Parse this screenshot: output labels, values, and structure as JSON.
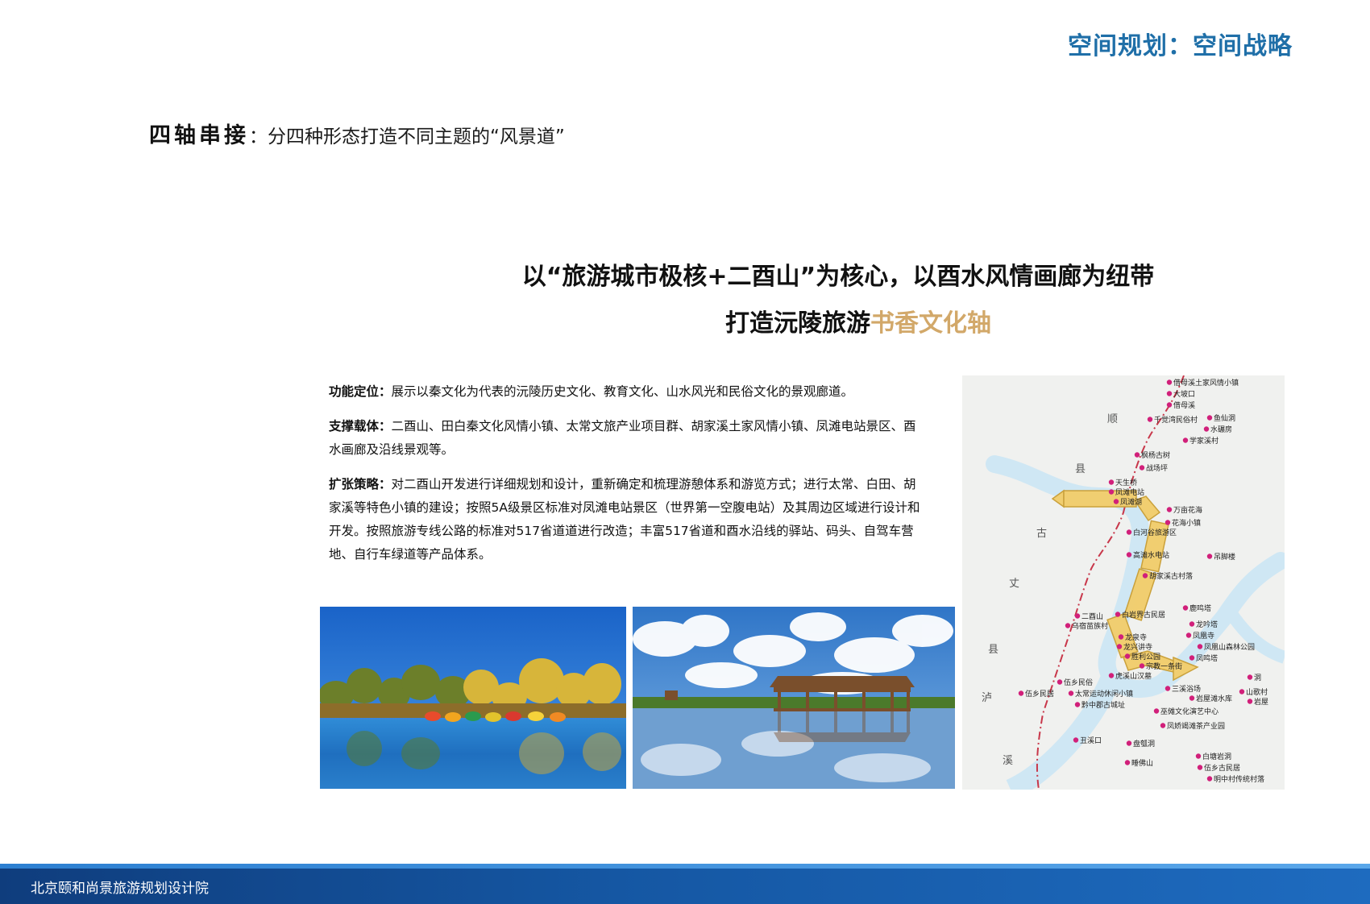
{
  "header": {
    "title": "空间规划：空间战略"
  },
  "section": {
    "axis_label": "四轴串接",
    "separator": "：",
    "subtitle": "分四种形态打造不同主题的“风景道”"
  },
  "headline": {
    "line1": "以“旅游城市极核+二酉山”为核心，以酉水风情画廊为纽带",
    "line2_prefix": "打造沅陵旅游",
    "line2_highlight": "书香文化轴"
  },
  "paragraphs": [
    {
      "label": "功能定位：",
      "text": "展示以秦文化为代表的沅陵历史文化、教育文化、山水风光和民俗文化的景观廊道。"
    },
    {
      "label": "支撑载体：",
      "text": "二酉山、田白秦文化风情小镇、太常文旅产业项目群、胡家溪土家风情小镇、凤滩电站景区、酉水画廊及沿线景观等。"
    },
    {
      "label": "扩张策略：",
      "text": "对二酉山开发进行详细规划和设计，重新确定和梳理游憩体系和游览方式；进行太常、白田、胡家溪等特色小镇的建设；按照5A级景区标准对凤滩电站景区（世界第一空腹电站）及其周边区域进行设计和开发。按照旅游专线公路的标准对517省道道进行改造；丰富517省道和酉水沿线的驿站、码头、自驾车营地、自行车绿道等产品体系。"
    }
  ],
  "map": {
    "county_labels": [
      "顺",
      "县",
      "古",
      "丈",
      "县",
      "泸",
      "溪"
    ],
    "places": [
      "借母溪土家风情小镇",
      "大坡口",
      "借母溪",
      "千觉湾民俗村",
      "鱼仙洞",
      "水碾房",
      "学家溪村",
      "枫杨古树",
      "战场坪",
      "天生桥",
      "凤滩电站",
      "凤滩湖",
      "万亩花海",
      "花海小镇",
      "白河谷旅游区",
      "高滩水电站",
      "吊脚楼",
      "胡家溪古村落",
      "鹿鸣塔",
      "二酉山",
      "白岩界古民居",
      "乌宿苗族村",
      "龙吟塔",
      "龙泉寺",
      "凤凰寺",
      "龙兴讲寺",
      "凤凰山森林公园",
      "胜利公园",
      "宗教一条街",
      "凤鸣塔",
      "虎溪山汉墓",
      "伍乡民居",
      "伍乡民俗",
      "太常运动休闲小镇",
      "黔中郡古城址",
      "三溪浴场",
      "岩屋滩水库",
      "山歌村",
      "洞",
      "岩屋",
      "巫傩文化演艺中心",
      "凤娇竭滩茶产业园",
      "丑溪口",
      "盘瓠洞",
      "白塘岩洞",
      "睡佛山",
      "伍乡古民居",
      "明中村传统村落"
    ]
  },
  "footer": {
    "org": "北京颐和尚景旅游规划设计院"
  }
}
